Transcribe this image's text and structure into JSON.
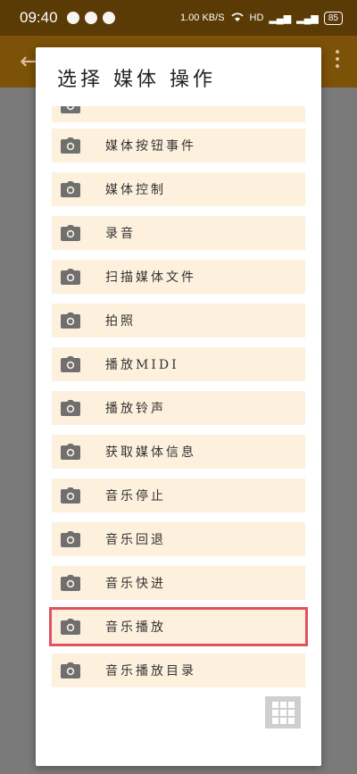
{
  "status_bar": {
    "time": "09:40",
    "speed": "1.00 KB/S",
    "hd": "HD",
    "battery": "85"
  },
  "dialog": {
    "title": "选择 媒体 操作",
    "items": [
      {
        "label": ""
      },
      {
        "label": "媒体按钮事件"
      },
      {
        "label": "媒体控制"
      },
      {
        "label": "录音"
      },
      {
        "label": "扫描媒体文件"
      },
      {
        "label": "拍照"
      },
      {
        "label": "播放MIDI"
      },
      {
        "label": "播放铃声"
      },
      {
        "label": "获取媒体信息"
      },
      {
        "label": "音乐停止"
      },
      {
        "label": "音乐回退"
      },
      {
        "label": "音乐快进"
      },
      {
        "label": "音乐播放",
        "selected": true
      },
      {
        "label": "音乐播放目录"
      }
    ]
  },
  "icons": {
    "item_icon": "camera-icon",
    "grid_button_icon": "grid-icon",
    "back_icon": "back-arrow-icon",
    "overflow_icon": "more-vertical-icon"
  },
  "colors": {
    "status_bar": "#5a3a05",
    "app_bar": "#7c5108",
    "item_bg": "#fdf0dd",
    "selected_outline": "#e0535e"
  }
}
